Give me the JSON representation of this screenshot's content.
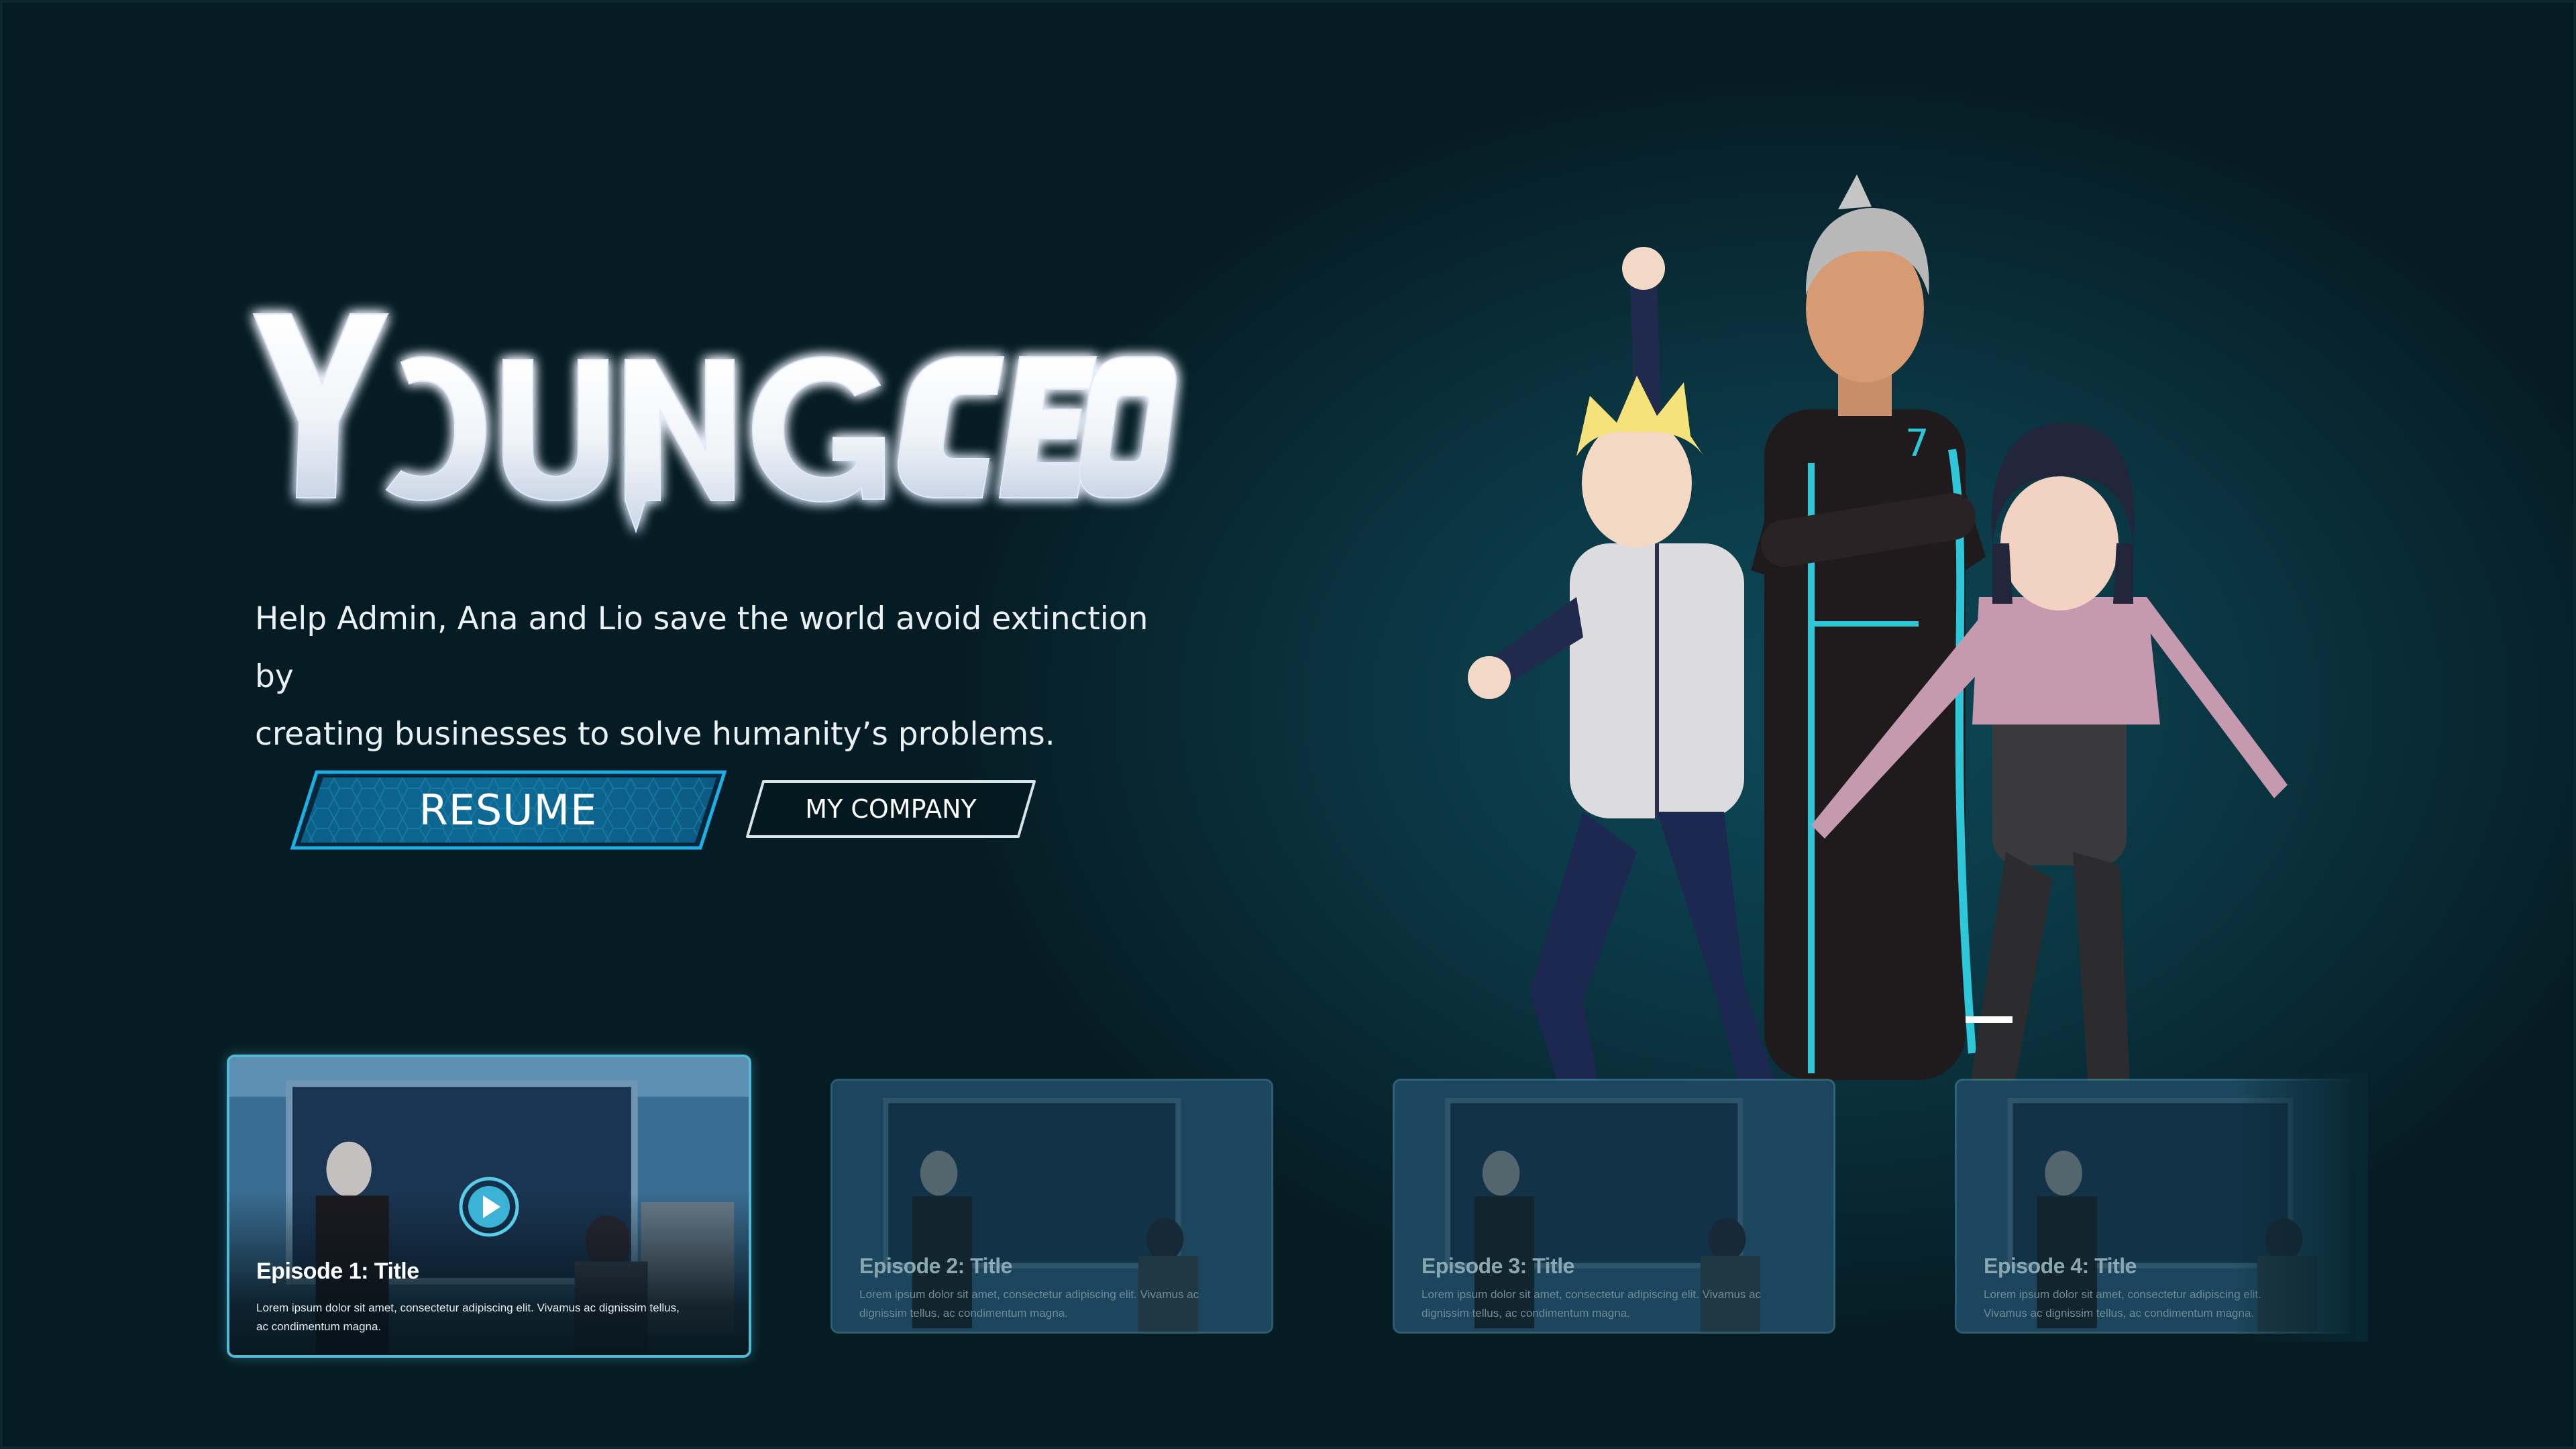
{
  "hero": {
    "logo_word1": "YOUNG",
    "logo_word2": "CEO",
    "tagline_line1": "Help Admin, Ana and Lio save the world avoid extinction by",
    "tagline_line2": "creating businesses to solve humanity’s problems."
  },
  "buttons": {
    "resume_label": "RESUME",
    "company_label": "MY COMPANY"
  },
  "episodes": [
    {
      "title": "Episode 1: Title",
      "description": "Lorem ipsum dolor sit amet, consectetur adipiscing elit. Vivamus ac dignissim tellus, ac condimentum magna.",
      "selected": true,
      "icon": "play-icon"
    },
    {
      "title": "Episode 2: Title",
      "description": "Lorem ipsum dolor sit amet, consectetur adipiscing elit. Vivamus ac dignissim tellus, ac condimentum magna.",
      "selected": false
    },
    {
      "title": "Episode 3: Title",
      "description": "Lorem ipsum dolor sit amet, consectetur adipiscing elit. Vivamus ac dignissim tellus, ac condimentum magna.",
      "selected": false
    },
    {
      "title": "Episode 4: Title",
      "description": "Lorem ipsum dolor sit amet, consectetur adipiscing elit. Vivamus ac dignissim tellus, ac condimentum magna.",
      "selected": false
    }
  ],
  "colors": {
    "background": "#061a21",
    "accent": "#2ec7d9",
    "resume_fill": "#0e6a96",
    "selected_border": "#55b8d2"
  }
}
